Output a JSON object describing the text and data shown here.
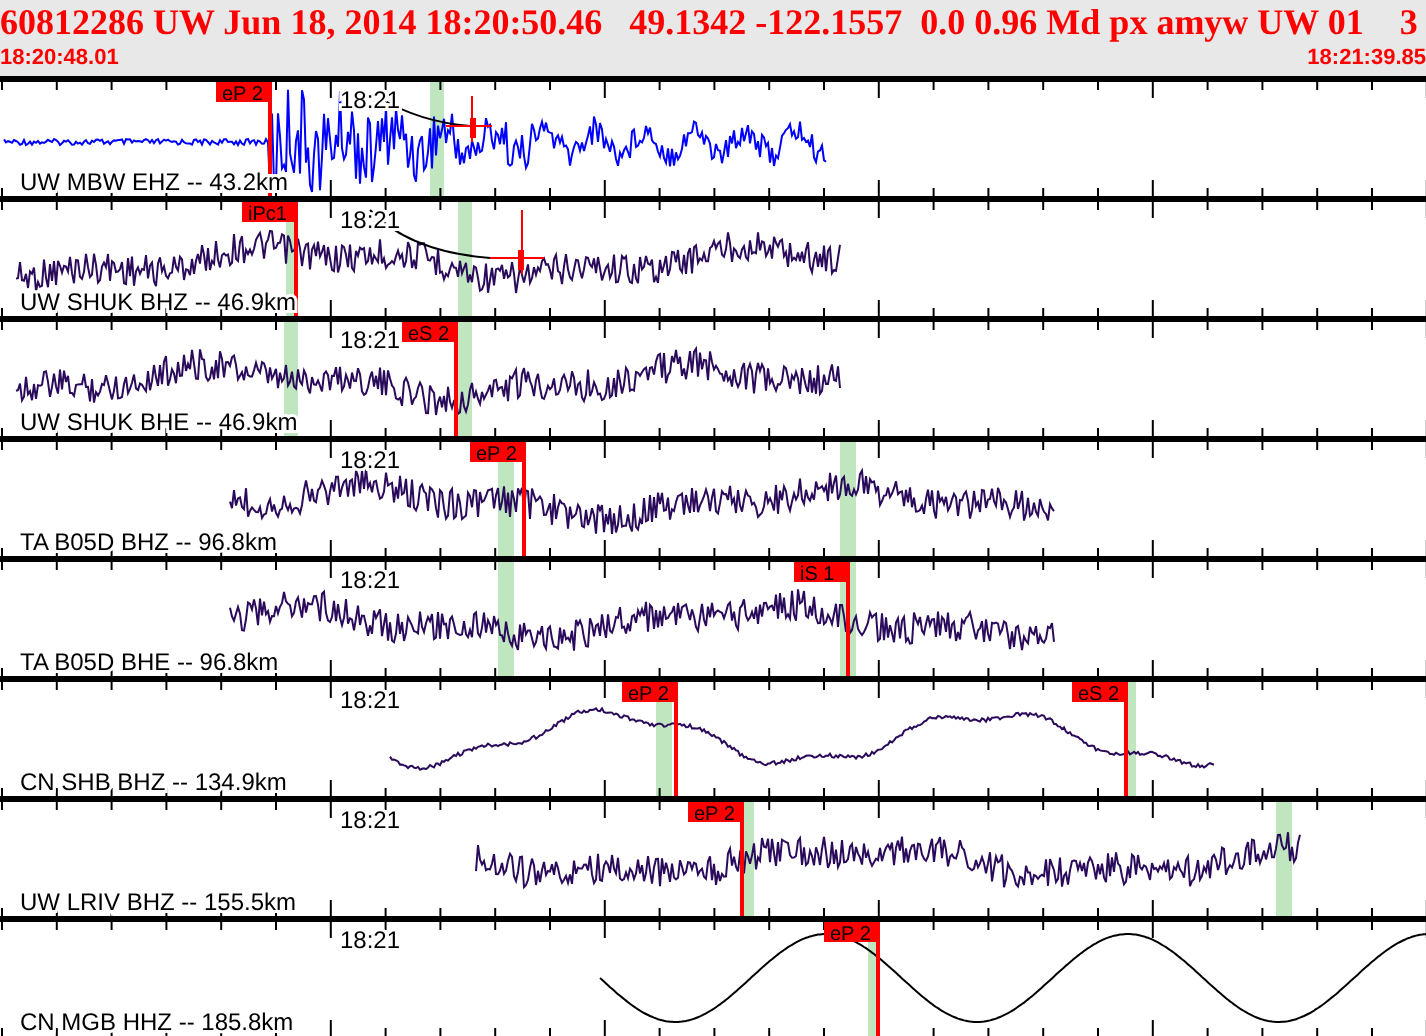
{
  "header": {
    "title": "60812286 UW Jun 18, 2014 18:20:50.46   49.1342 -122.1557  0.0 0.96 Md px amyw UW 01    3",
    "start_time": "18:20:48.01",
    "end_time": "18:21:39.85"
  },
  "channels": [
    {
      "label": "UW MBW EHZ -- 43.2km",
      "time_mark": "18:21",
      "color": "#0000ff",
      "picks": [
        {
          "label": "eP 2"
        }
      ]
    },
    {
      "label": "UW SHUK BHZ -- 46.9km",
      "time_mark": "18:21",
      "color": "#2a0a5a",
      "picks": [
        {
          "label": "iPc1"
        }
      ]
    },
    {
      "label": "UW SHUK BHE -- 46.9km",
      "time_mark": "18:21",
      "color": "#2a0a5a",
      "picks": [
        {
          "label": "eS 2"
        }
      ]
    },
    {
      "label": "TA B05D BHZ -- 96.8km",
      "time_mark": "18:21",
      "color": "#2a0a5a",
      "picks": [
        {
          "label": "eP 2"
        }
      ]
    },
    {
      "label": "TA B05D BHE -- 96.8km",
      "time_mark": "18:21",
      "color": "#2a0a5a",
      "picks": [
        {
          "label": "iS 1"
        }
      ]
    },
    {
      "label": "CN SHB BHZ -- 134.9km",
      "time_mark": "18:21",
      "color": "#2a0a5a",
      "picks": [
        {
          "label": "eP 2"
        },
        {
          "label": "eS 2"
        }
      ]
    },
    {
      "label": "UW LRIV BHZ -- 155.5km",
      "time_mark": "18:21",
      "color": "#2a0a5a",
      "picks": [
        {
          "label": "eP 2"
        }
      ]
    },
    {
      "label": "CN MGB HHZ -- 185.8km",
      "time_mark": "18:21",
      "color": "#000000",
      "picks": [
        {
          "label": "eP 2"
        }
      ]
    }
  ]
}
